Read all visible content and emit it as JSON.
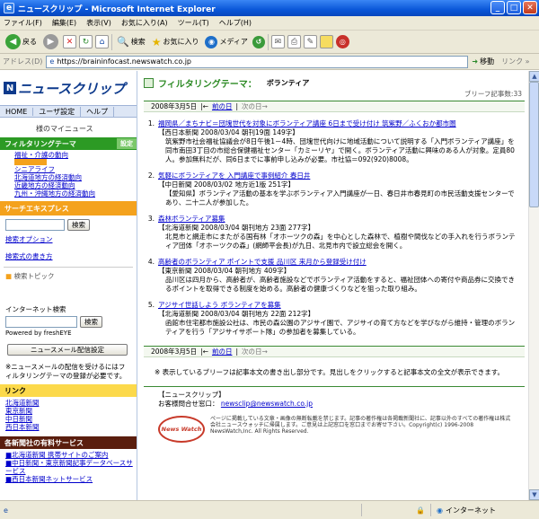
{
  "window": {
    "title": "ニュースクリップ - Microsoft Internet Explorer"
  },
  "menu": [
    "ファイル(F)",
    "編集(E)",
    "表示(V)",
    "お気に入り(A)",
    "ツール(T)",
    "ヘルプ(H)"
  ],
  "toolbar": {
    "back": "戻る",
    "search": "検索",
    "favorites": "お気に入り",
    "media": "メディア"
  },
  "address": {
    "label": "アドレス(D)",
    "url": "https://braininfocast.newswatch.co.jp",
    "go": "移動",
    "links": "リンク »"
  },
  "sidebar": {
    "logo": "ニュースクリップ",
    "nav": [
      "HOME",
      "ユーザ設定",
      "ヘルプ"
    ],
    "mynews": "様のマイニュース",
    "filter_header": "フィルタリングテーマ",
    "filter_settings": "設定",
    "filter_items": [
      "福祉・介護の動向",
      "ボランティア",
      "シニアライフ",
      "北海道地方の経済動向",
      "近畿地方の経済動向",
      "九州・沖縄地方の経済動向"
    ],
    "search_header": "サーチエキスプレス",
    "search_button": "検索",
    "search_option": "検索オプション",
    "search_howto": "検索式の書き方",
    "search_topics": "検索トピック",
    "internet_search": "インターネット検索",
    "internet_search_button": "検索",
    "powered": "Powered by freshEYE",
    "newsmail_button": "ニュースメール配信設定",
    "newsmail_note": "※ニュースメールの配信を受けるにはフィルタリングテーマの登録が必要です。",
    "links_header": "リンク",
    "links": [
      "北海道新聞",
      "東京新聞",
      "中日新聞",
      "西日本新聞"
    ],
    "paid_header": "各新聞社の有料サービス",
    "paid": [
      "■北海道新聞 携帯サイトのご案内",
      "■中日新聞・東京新聞記事データベースサービス",
      "■西日本新聞ネットサービス"
    ]
  },
  "main": {
    "theme_label": "フィルタリングテーマ：",
    "theme_value": "ボランティア",
    "count": "ブリーフ記事数:33",
    "date": "2008年3月5日",
    "prev": "前の日",
    "next": "次の日→",
    "articles": [
      {
        "num": "1.",
        "title": "福岡県／まちナビ＝団塊世代を対象にボランティア講座 6日まで受け付け 筑紫野／ふくおか都市圏",
        "source": "【西日本新聞 2008/03/04 朝刊19面 149字】",
        "text": "筑紫野市社会福祉協議会が8日午後1－4時、団塊世代向けに地域活動について説明する「入門ボランティア講座」を同市南田3丁目の市総合保健福祉センター「カミーリヤ」で開く。ボランティア活動に興味のある人が対象。定員80人。参加無料だが、同6日までに事前申し込みが必要。市社協＝092(920)8008。"
      },
      {
        "num": "2.",
        "title": "気軽にボランティアを 入門講座で事例紹介 春日井",
        "source": "【中日新聞 2008/03/02 地方近1版 251字】",
        "text": "【愛知県】ボランティア活動の基本を学ぶボランティア入門講座が一日、春日井市春見町の市民活動支援センターであり、二十二人が参加した。"
      },
      {
        "num": "3.",
        "title": "森林ボランティア募集",
        "source": "【北海道新聞 2008/03/04 朝刊地方 23面 277字】",
        "text": "北見市と網走市にまたがる国有林「オホーツクの森」を中心とした森林で、植樹や間伐などの手入れを行うボランティア団体「オホーツクの森」(網師平会長)が九日、北見市内で設立総会を開く。"
      },
      {
        "num": "4.",
        "title": "高齢者のボランティア ポイントで支援 品川区 来月から登録受け付け",
        "source": "【東京新聞 2008/03/04 朝刊地方 409字】",
        "text": "品川区は四月から、高齢者が、高齢者施設などでボランティア活動をすると、福祉団体への寄付や商品券に交換できるポイントを取得できる制度を始める。高齢者の健康づくりなどを狙った取り組み。"
      },
      {
        "num": "5.",
        "title": "アジサイ世話しよう ボランティアを募集",
        "source": "【北海道新聞 2008/03/04 朝刊地方 22面 212字】",
        "text": "函館市住宅都市施設公社は、市民の森公園のアジサイ園で、アジサイの育て方などを学びながら維持・管理のボランティアを行う「アジサイサポート隊」の参加者を募集している。"
      }
    ],
    "note": "※ 表示しているブリーフは記事本文の書き出し部分です。見出しをクリックすると記事本文の全文が表示できます。",
    "footer_title": "【ニュースクリップ】",
    "footer_contact": "お客様問合せ窓口：",
    "footer_email": "newsclip@newswatch.co.jp",
    "footer_logo": "News Watch",
    "footer_text": "ページに掲載している文章・画像の無断転載を禁じます。記事の著作権は各掲載新聞社に、記事以外のすべての著作権は株式会社ニュースウォッチに帰属します。ご意見は上記窓口を窓口までお寄せ下さい。Copyright(c) 1996-2008 NewsWatch,Inc. All Rights Reserved."
  },
  "status": {
    "zone": "インターネット"
  }
}
